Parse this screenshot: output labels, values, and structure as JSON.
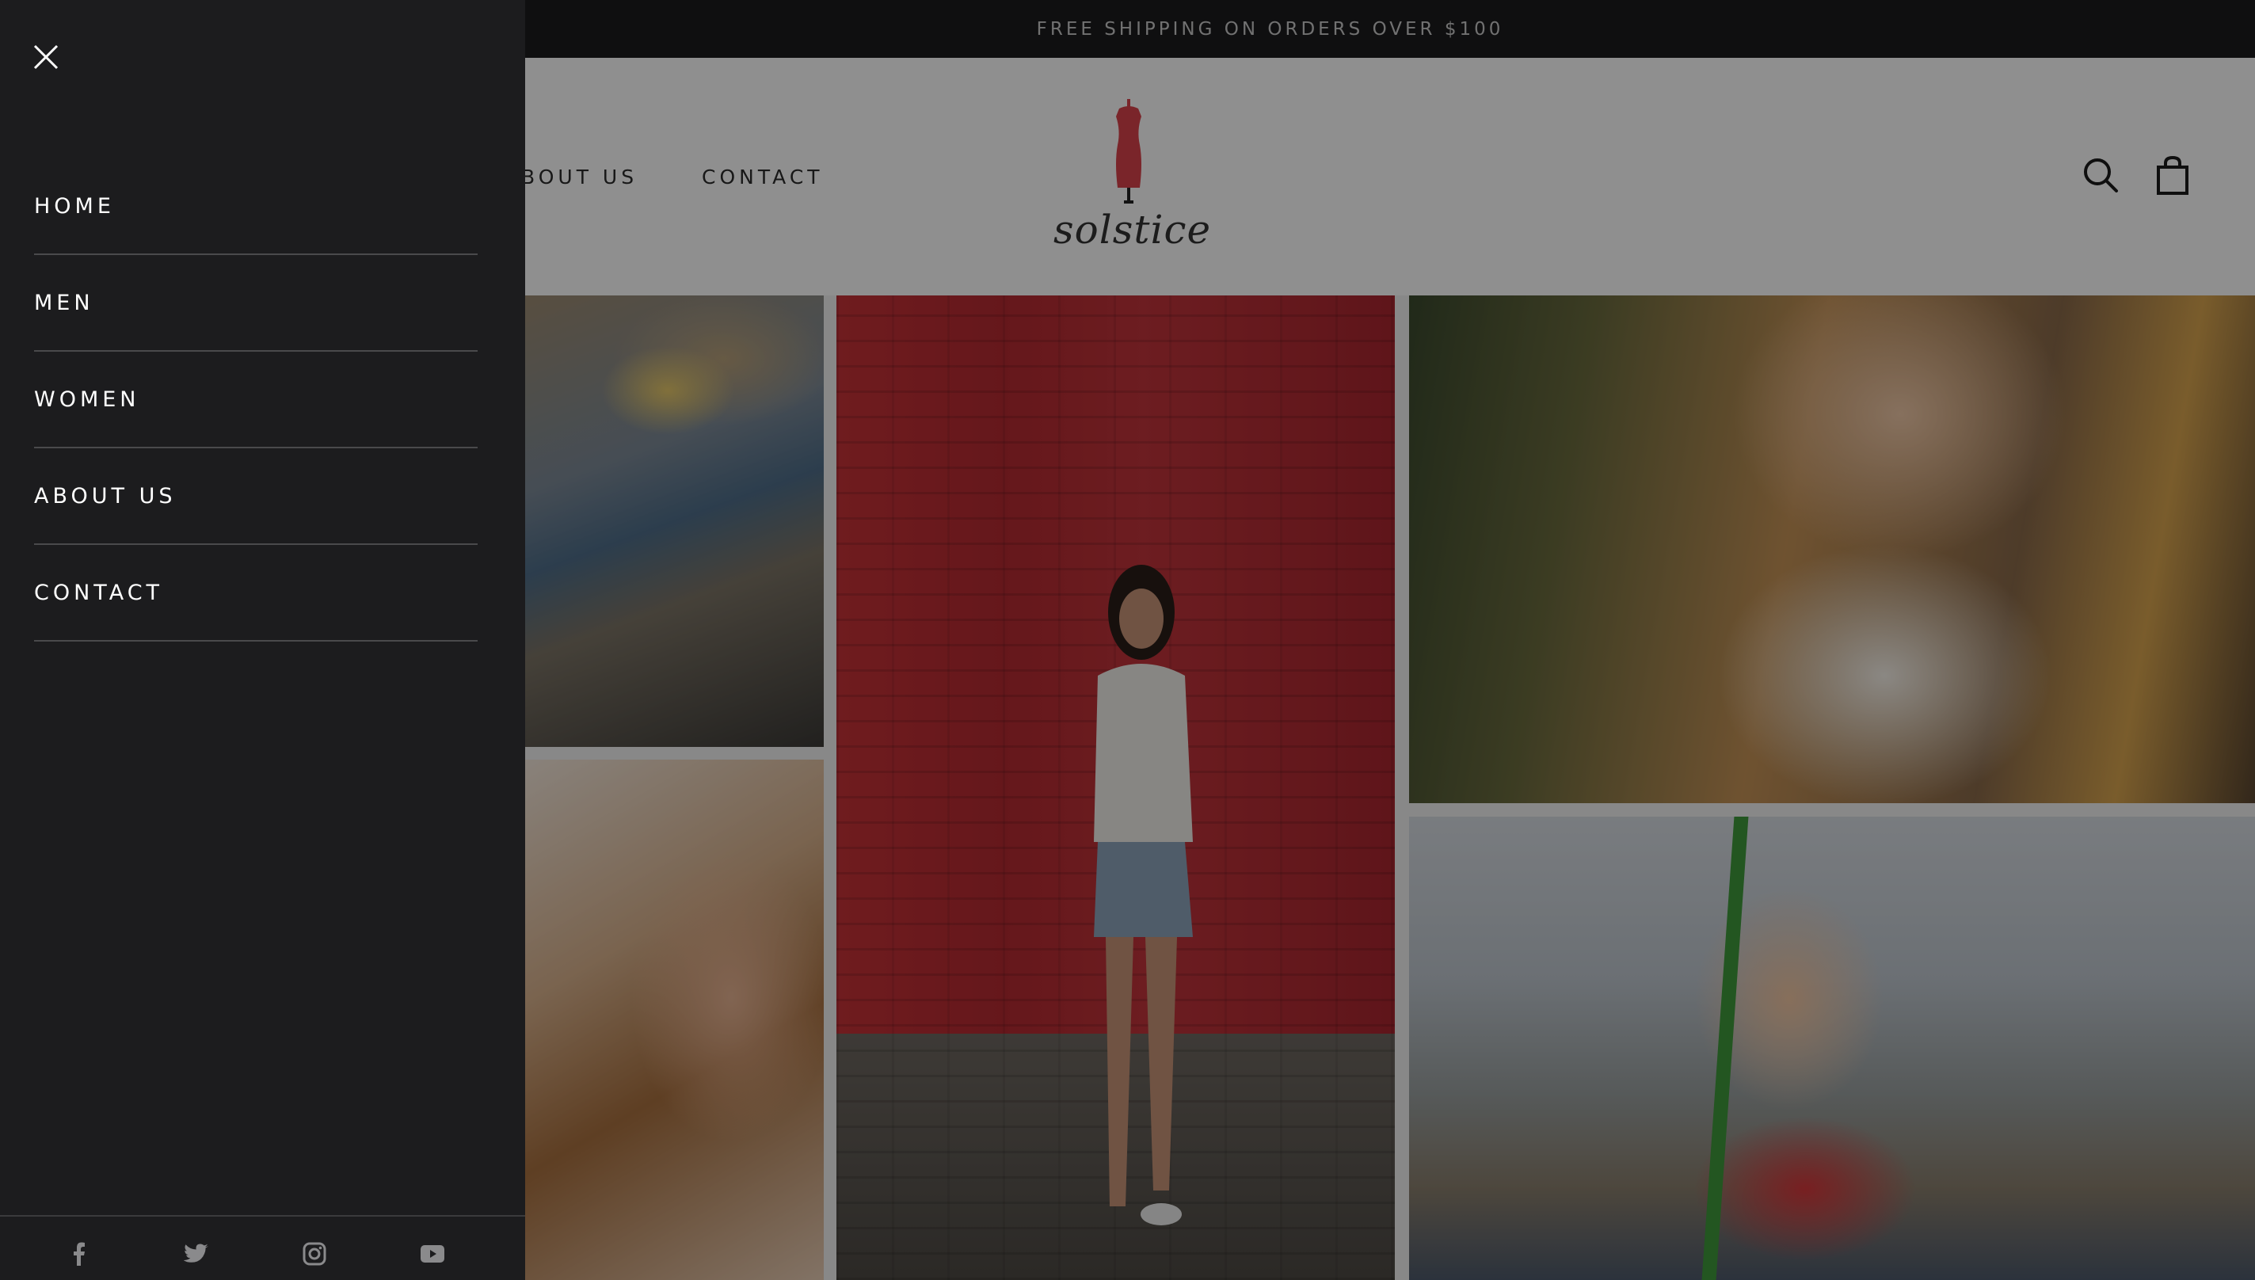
{
  "announcement": {
    "text": "FREE SHIPPING ON ORDERS OVER $100"
  },
  "header": {
    "nav_visible": [
      {
        "label": "BOUT US"
      },
      {
        "label": "CONTACT"
      }
    ],
    "logo_text": "solstice",
    "icons": [
      "search-icon",
      "shopping-bag-icon"
    ]
  },
  "drawer": {
    "close_icon": "close-icon",
    "menu_items": [
      {
        "label": "HOME"
      },
      {
        "label": "MEN"
      },
      {
        "label": "WOMEN"
      },
      {
        "label": "ABOUT US"
      },
      {
        "label": "CONTACT"
      }
    ],
    "social_icons": [
      "facebook-icon",
      "twitter-icon",
      "instagram-icon",
      "youtube-icon"
    ]
  },
  "colors": {
    "drawer_bg": "#1c1c1e",
    "logo_accent": "#d9434b",
    "overlay": "rgba(0,0,0,0.44)"
  }
}
